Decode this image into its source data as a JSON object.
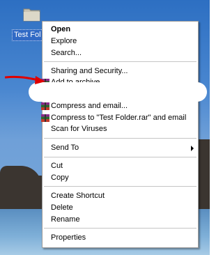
{
  "desktop": {
    "folder_label": "Test Fol"
  },
  "menu": {
    "items": [
      {
        "label": "Open",
        "bold": true
      },
      {
        "label": "Explore"
      },
      {
        "label": "Search..."
      },
      {
        "label": "Sharing and Security..."
      },
      {
        "label": "Add to archive...",
        "icon": "winrar-icon"
      },
      {
        "label": "Compress and email...",
        "icon": "winrar-icon"
      },
      {
        "label": "Compress to \"Test Folder.rar\" and email",
        "icon": "winrar-icon"
      },
      {
        "label": "Scan for Viruses"
      },
      {
        "label": "Send To",
        "submenu": true
      },
      {
        "label": "Cut"
      },
      {
        "label": "Copy"
      },
      {
        "label": "Create Shortcut"
      },
      {
        "label": "Delete"
      },
      {
        "label": "Rename"
      },
      {
        "label": "Properties"
      }
    ]
  },
  "colors": {
    "selection": "#316ac5",
    "annotation_arrow": "#e00000"
  }
}
